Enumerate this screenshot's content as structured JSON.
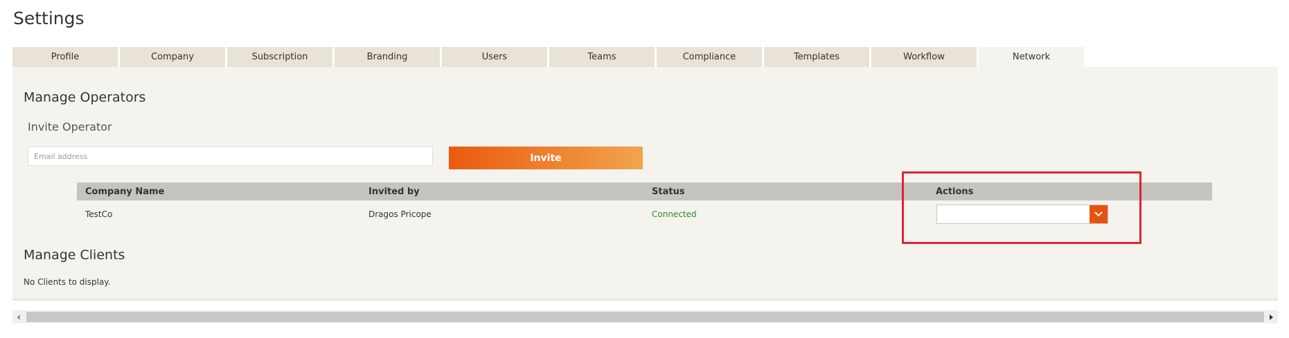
{
  "page": {
    "title": "Settings"
  },
  "tabs": [
    {
      "label": "Profile"
    },
    {
      "label": "Company"
    },
    {
      "label": "Subscription"
    },
    {
      "label": "Branding"
    },
    {
      "label": "Users"
    },
    {
      "label": "Teams"
    },
    {
      "label": "Compliance"
    },
    {
      "label": "Templates"
    },
    {
      "label": "Workflow"
    },
    {
      "label": "Network",
      "active": true
    }
  ],
  "operators": {
    "title": "Manage Operators",
    "invite_title": "Invite Operator",
    "email_placeholder": "Email address",
    "email_value": "",
    "invite_label": "Invite",
    "table": {
      "columns": [
        "Company Name",
        "Invited by",
        "Status",
        "Actions"
      ],
      "rows": [
        {
          "company": "TestCo",
          "invited_by": "Dragos Pricope",
          "status": "Connected",
          "action_value": ""
        }
      ]
    }
  },
  "clients": {
    "title": "Manage Clients",
    "empty_text": "No Clients to display."
  },
  "colors": {
    "accent": "#e8520f",
    "status_connected": "#2e8a2e",
    "highlight": "#e0242f",
    "tab_bg": "#e8e3d6",
    "panel_bg": "#f5f3ee"
  },
  "icons": {
    "dropdown": "chevron-down-icon",
    "scroll_left": "arrow-left-icon",
    "scroll_right": "arrow-right-icon"
  }
}
